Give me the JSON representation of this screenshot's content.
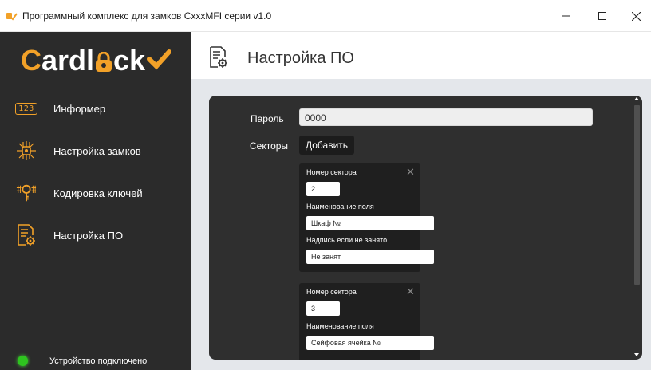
{
  "window": {
    "title": "Программный комплекс для замков CxxxMFI серии v1.0",
    "app_icon": "lock-check-icon",
    "minimize_icon": "minimize-icon",
    "maximize_icon": "maximize-icon",
    "close_icon": "close-icon"
  },
  "sidebar": {
    "logo": {
      "first": "C",
      "middle": "ardl",
      "end": "ck"
    },
    "items": [
      {
        "label": "Информер",
        "icon": "counter-123-icon",
        "icon_text": "123"
      },
      {
        "label": "Настройка замков",
        "icon": "circuit-lock-icon"
      },
      {
        "label": "Кодировка ключей",
        "icon": "key-circuit-icon"
      },
      {
        "label": "Настройка ПО",
        "icon": "settings-document-icon"
      }
    ],
    "status": {
      "text": "Устройство подключено",
      "color": "#2ec41f"
    }
  },
  "header": {
    "title": "Настройка ПО",
    "icon": "settings-document-icon"
  },
  "form": {
    "password_label": "Пароль",
    "password_value": "0000",
    "sectors_label": "Секторы",
    "add_button": "Добавить",
    "sectors": [
      {
        "number_label": "Номер сектора",
        "number": "2",
        "field_name_label": "Наименование поля",
        "field_name": "Шкаф №",
        "empty_label": "Надпись если не занято",
        "empty_text": "Не занят"
      },
      {
        "number_label": "Номер сектора",
        "number": "3",
        "field_name_label": "Наименование поля",
        "field_name": "Сейфовая ячейка №"
      }
    ]
  },
  "colors": {
    "accent": "#f2a128",
    "sidebar_bg": "#2b2b2b",
    "panel_bg": "#2f2f2f",
    "content_bg": "#e4e7eb"
  }
}
